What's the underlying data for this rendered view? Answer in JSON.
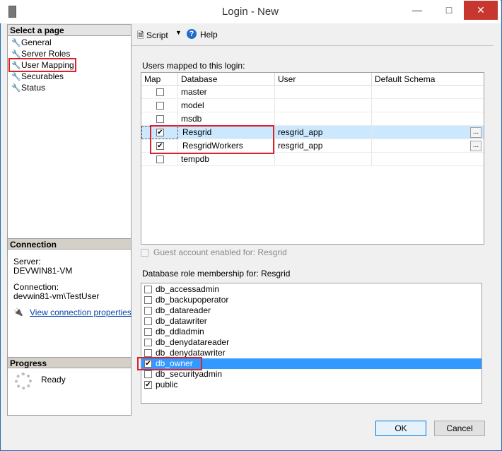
{
  "window": {
    "title": "Login - New"
  },
  "left_pane": {
    "select_page_header": "Select a page",
    "pages": [
      "General",
      "Server Roles",
      "User Mapping",
      "Securables",
      "Status"
    ],
    "connection_header": "Connection",
    "server_label": "Server:",
    "server_value": "DEVWIN81-VM",
    "connection_label": "Connection:",
    "connection_value": "devwin81-vm\\TestUser",
    "view_props_link": "View connection properties",
    "progress_header": "Progress",
    "progress_status": "Ready"
  },
  "toolbar": {
    "script_label": "Script",
    "help_label": "Help"
  },
  "mapping": {
    "section_label": "Users mapped to this login:",
    "columns": [
      "Map",
      "Database",
      "User",
      "Default Schema"
    ],
    "rows": [
      {
        "checked": false,
        "database": "master",
        "user": "",
        "schema": ""
      },
      {
        "checked": false,
        "database": "model",
        "user": "",
        "schema": ""
      },
      {
        "checked": false,
        "database": "msdb",
        "user": "",
        "schema": ""
      },
      {
        "checked": true,
        "database": "Resgrid",
        "user": "resgrid_app",
        "schema": "",
        "selected": true
      },
      {
        "checked": true,
        "database": "ResgridWorkers",
        "user": "resgrid_app",
        "schema": ""
      },
      {
        "checked": false,
        "database": "tempdb",
        "user": "",
        "schema": ""
      }
    ],
    "browse_label": "...",
    "guest_label": "Guest account enabled for: Resgrid"
  },
  "roles": {
    "section_label": "Database role membership for: Resgrid",
    "items": [
      {
        "name": "db_accessadmin",
        "checked": false
      },
      {
        "name": "db_backupoperator",
        "checked": false
      },
      {
        "name": "db_datareader",
        "checked": false
      },
      {
        "name": "db_datawriter",
        "checked": false
      },
      {
        "name": "db_ddladmin",
        "checked": false
      },
      {
        "name": "db_denydatareader",
        "checked": false
      },
      {
        "name": "db_denydatawriter",
        "checked": false
      },
      {
        "name": "db_owner",
        "checked": true,
        "selected": true
      },
      {
        "name": "db_securityadmin",
        "checked": false
      },
      {
        "name": "public",
        "checked": true
      }
    ]
  },
  "buttons": {
    "ok": "OK",
    "cancel": "Cancel"
  },
  "colors": {
    "selection": "#3399ff",
    "row_highlight": "#cce8ff",
    "highlight_box": "#d9222a",
    "link": "#0645ad"
  }
}
